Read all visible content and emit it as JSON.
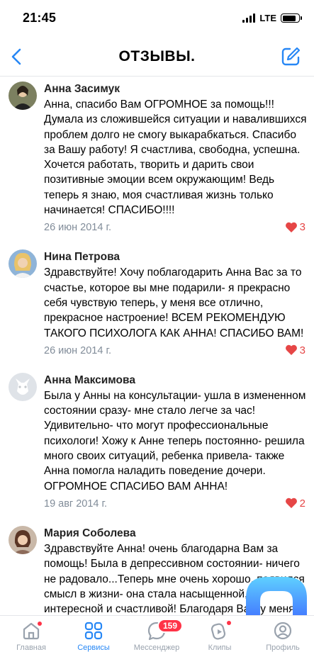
{
  "status_bar": {
    "time": "21:45",
    "network": "LTE",
    "battery_level": 0.85
  },
  "header": {
    "title": "ОТЗЫВЫ.",
    "back_icon": "chevron-left-icon",
    "compose_icon": "compose-icon"
  },
  "reviews": [
    {
      "author": "Анна Засимук",
      "text": "Анна, спасибо Вам ОГРОМНОЕ за помощь!!! Думала из сложившейся ситуации и навалившихся проблем долго не смогу выкарабкаться. Спасибо за Вашу работу! Я счастлива, свободна, успешна. Хочется работать, творить и дарить свои позитивные эмоции всем окружающим! Ведь теперь я знаю, моя счастливая жизнь только начинается! СПАСИБО!!!!",
      "date": "26 июн 2014 г.",
      "likes": "3"
    },
    {
      "author": "Нина Петрова",
      "text": "Здравствуйте! Хочу поблагодарить Анна Вас за то счастье, которое вы мне подарили- я прекрасно себя чувствую теперь, у меня все отлично, прекрасное настроение! ВСЕМ РЕКОМЕНДУЮ ТАКОГО ПСИХОЛОГА КАК АННА! СПАСИБО ВАМ!",
      "date": "26 июн 2014 г.",
      "likes": "3"
    },
    {
      "author": "Анна Максимова",
      "text": "Была у Анны на консультации- ушла в измененном состоянии сразу- мне стало легче за час! Удивительно- что могут профессиональные психологи! Хожу к Анне теперь постоянно- решила много своих ситуаций, ребенка привела- также Анна помогла наладить поведение дочери. ОГРОМНОЕ СПАСИБО ВАМ АННА!",
      "date": "19 авг 2014 г.",
      "likes": "2"
    },
    {
      "author": "Мария Соболева",
      "text": "Здравствуйте Анна! очень благодарна Вам за помощь! Была в депрессивном состоянии- ничего не радовало...Теперь мне очень хорошо, появился смысл в жизни- она стала насыщенной, интересной и счастливой! Благодаря Вам у меня появился смысл в жизни! Я строю свою карьеру, легко общаюсь с мужчинами, наладила",
      "date": "",
      "likes": ""
    }
  ],
  "tab_bar": {
    "items": [
      {
        "label": "Главная",
        "icon": "home-icon",
        "active": false
      },
      {
        "label": "Сервисы",
        "icon": "services-grid-icon",
        "active": true
      },
      {
        "label": "Мессенджер",
        "icon": "messenger-icon",
        "active": false,
        "badge": "159"
      },
      {
        "label": "Клипы",
        "icon": "clips-icon",
        "active": false
      },
      {
        "label": "Профиль",
        "icon": "profile-icon",
        "active": false
      }
    ]
  },
  "colors": {
    "accent": "#2787f5",
    "like": "#e64646",
    "secondary_text": "#818c99",
    "badge": "#ff3347"
  }
}
